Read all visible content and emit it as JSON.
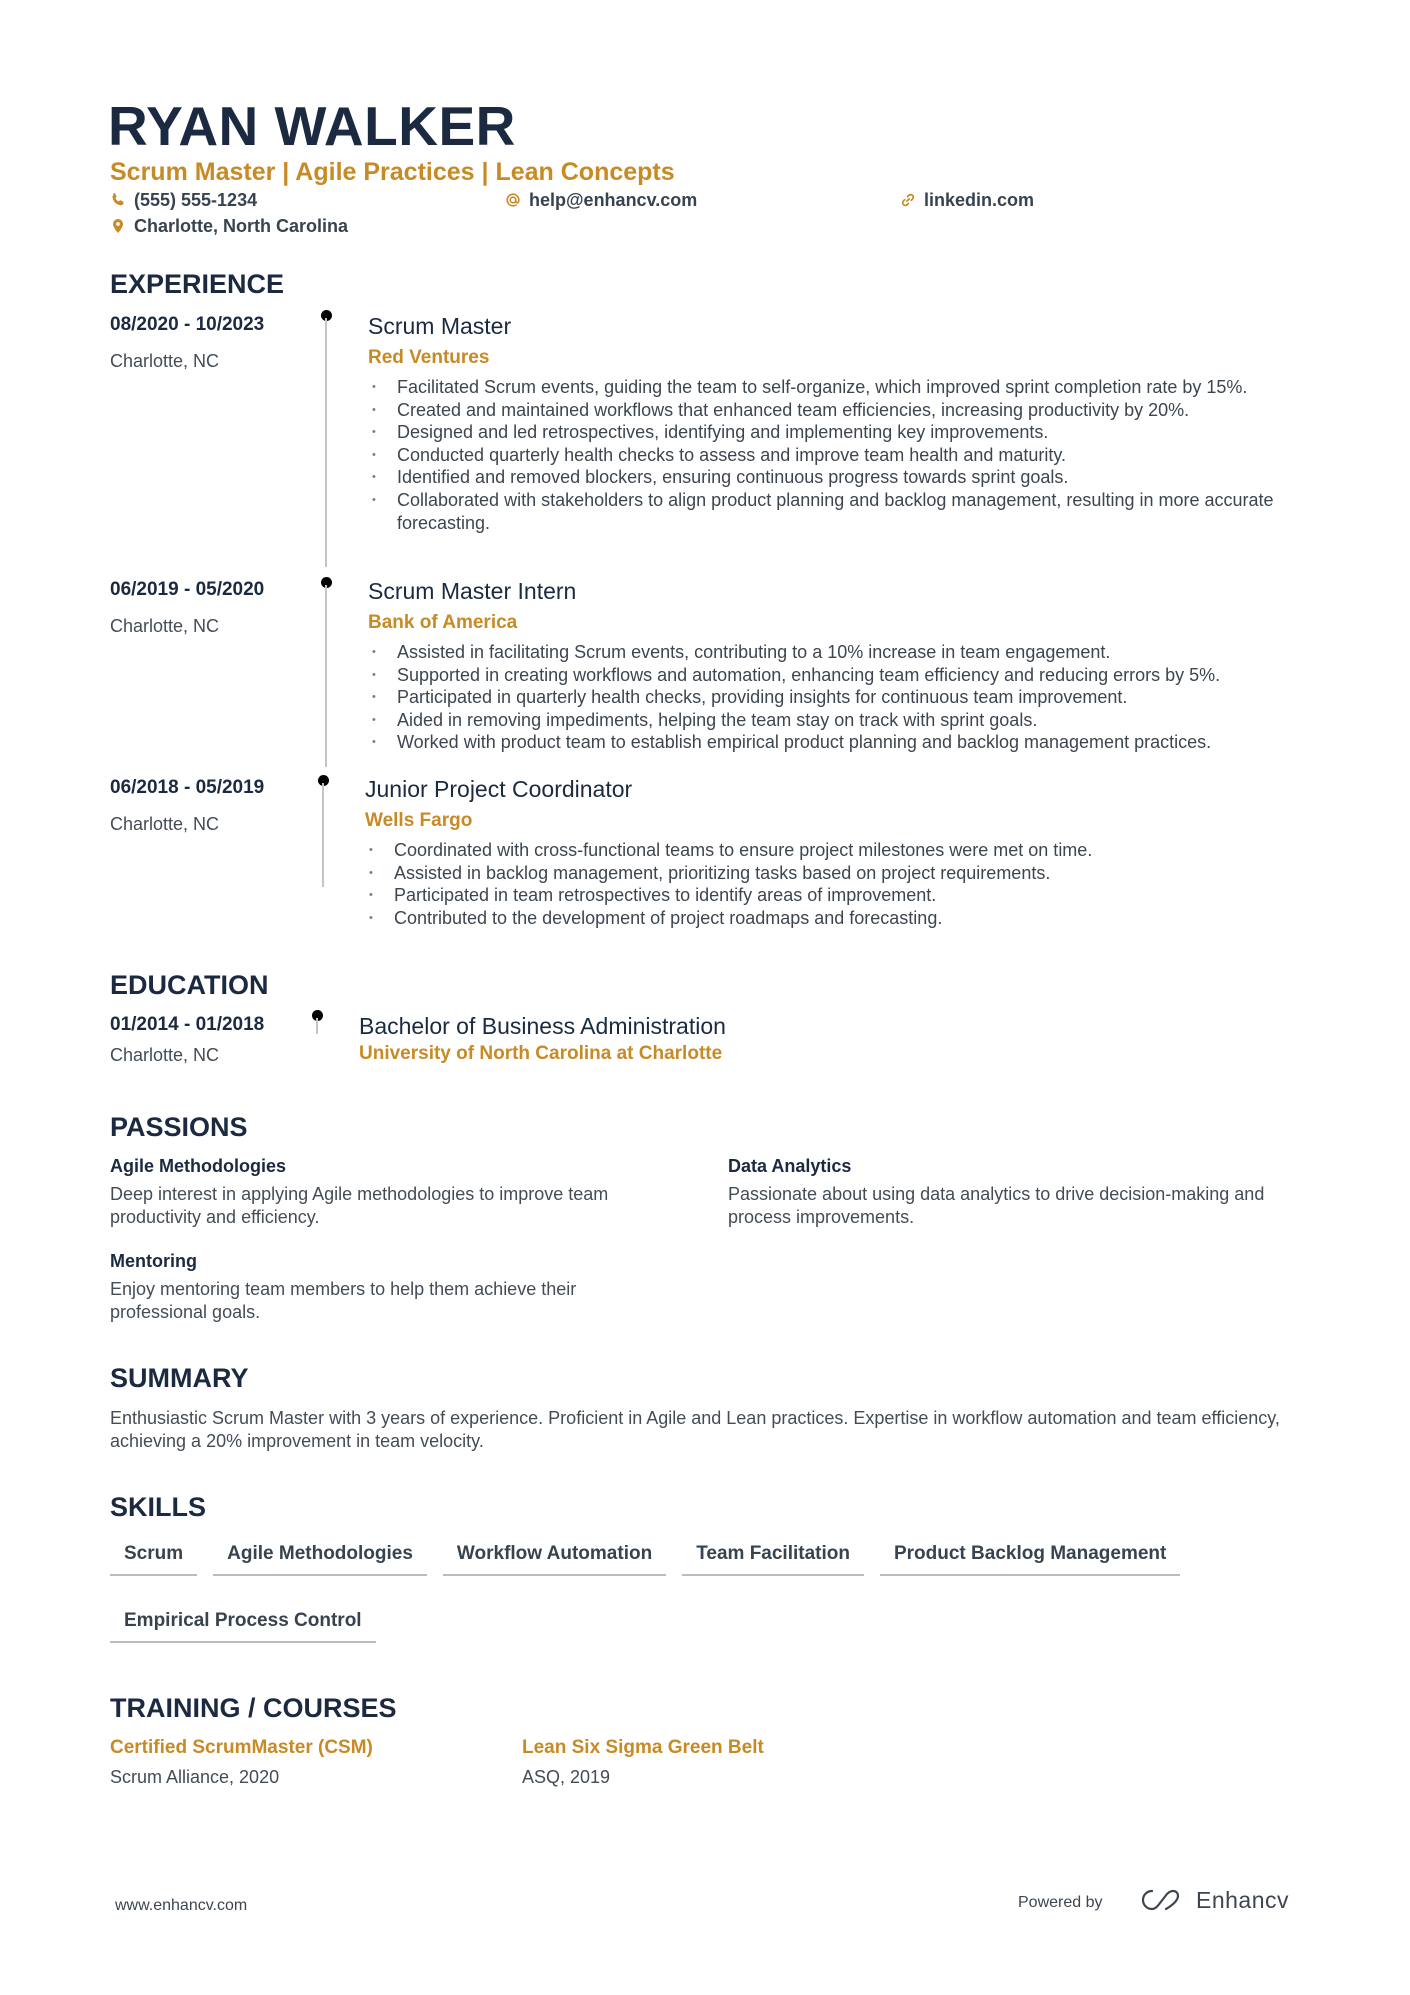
{
  "header": {
    "name": "RYAN WALKER",
    "subtitle": "Scrum Master | Agile Practices | Lean Concepts",
    "contacts": {
      "phone": {
        "icon": "phone-icon",
        "text": "(555) 555-1234"
      },
      "email": {
        "icon": "at-icon",
        "text": "help@enhancv.com"
      },
      "linkedin": {
        "icon": "link-icon",
        "text": "linkedin.com"
      },
      "location": {
        "icon": "location-pin-icon",
        "text": "Charlotte, North Carolina"
      }
    }
  },
  "colors": {
    "accent": "#c88a24",
    "heading": "#1b2a40",
    "body": "#444c56",
    "timeline": "#c4c4c4"
  },
  "experience": {
    "title": "EXPERIENCE",
    "items": [
      {
        "dates": "08/2020 - 10/2023",
        "location": "Charlotte, NC",
        "role": "Scrum Master",
        "company": "Red Ventures",
        "bullets": [
          "Facilitated Scrum events, guiding the team to self-organize, which improved sprint completion rate by 15%.",
          "Created and maintained workflows that enhanced team efficiencies, increasing productivity by 20%.",
          "Designed and led retrospectives, identifying and implementing key improvements.",
          "Conducted quarterly health checks to assess and improve team health and maturity.",
          "Identified and removed blockers, ensuring continuous progress towards sprint goals.",
          "Collaborated with stakeholders to align product planning and backlog management, resulting in more accurate forecasting."
        ]
      },
      {
        "dates": "06/2019 - 05/2020",
        "location": "Charlotte, NC",
        "role": "Scrum Master Intern",
        "company": "Bank of America",
        "bullets": [
          "Assisted in facilitating Scrum events, contributing to a 10% increase in team engagement.",
          "Supported in creating workflows and automation, enhancing team efficiency and reducing errors by 5%.",
          "Participated in quarterly health checks, providing insights for continuous team improvement.",
          "Aided in removing impediments, helping the team stay on track with sprint goals.",
          "Worked with product team to establish empirical product planning and backlog management practices."
        ]
      },
      {
        "dates": "06/2018 - 05/2019",
        "location": "Charlotte, NC",
        "role": "Junior Project Coordinator",
        "company": "Wells Fargo",
        "bullets": [
          "Coordinated with cross-functional teams to ensure project milestones were met on time.",
          "Assisted in backlog management, prioritizing tasks based on project requirements.",
          "Participated in team retrospectives to identify areas of improvement.",
          "Contributed to the development of project roadmaps and forecasting."
        ]
      }
    ]
  },
  "education": {
    "title": "EDUCATION",
    "items": [
      {
        "dates": "01/2014 - 01/2018",
        "location": "Charlotte, NC",
        "degree": "Bachelor of Business Administration",
        "school": "University of North Carolina at Charlotte"
      }
    ]
  },
  "passions": {
    "title": "PASSIONS",
    "items": [
      {
        "title": "Agile Methodologies",
        "desc": "Deep interest in applying Agile methodologies to improve team productivity and efficiency."
      },
      {
        "title": "Data Analytics",
        "desc": "Passionate about using data analytics to drive decision-making and process improvements."
      },
      {
        "title": "Mentoring",
        "desc": "Enjoy mentoring team members to help them achieve their professional goals."
      }
    ]
  },
  "summary": {
    "title": "SUMMARY",
    "text": "Enthusiastic Scrum Master with 3 years of experience. Proficient in Agile and Lean practices. Expertise in workflow automation and team efficiency, achieving a 20% improvement in team velocity."
  },
  "skills": {
    "title": "SKILLS",
    "items": [
      "Scrum",
      "Agile Methodologies",
      "Workflow Automation",
      "Team Facilitation",
      "Product Backlog Management",
      "Empirical Process Control"
    ]
  },
  "training": {
    "title": "TRAINING / COURSES",
    "items": [
      {
        "title": "Certified ScrumMaster (CSM)",
        "sub": "Scrum Alliance, 2020"
      },
      {
        "title": "Lean Six Sigma Green Belt",
        "sub": "ASQ, 2019"
      }
    ]
  },
  "footer": {
    "website": "www.enhancv.com",
    "powered_by": "Powered by",
    "brand": "Enhancv",
    "brand_icon": "enhancv-logo-icon"
  }
}
